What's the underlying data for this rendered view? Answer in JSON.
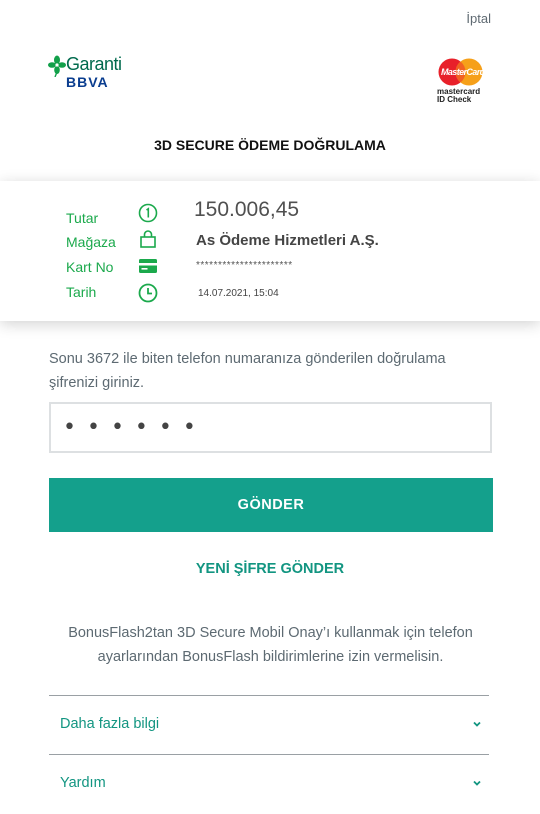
{
  "header": {
    "cancel_label": "İptal",
    "bank_logo": {
      "line1": "Garanti",
      "line2": "BBVA",
      "icon": "clover-logo-icon"
    },
    "card_logo": {
      "word": "MasterCard",
      "line1": "mastercard",
      "line2": "ID Check",
      "icon": "mastercard-logo-icon"
    }
  },
  "title": "3D SECURE ÖDEME DOĞRULAMA",
  "summary": {
    "rows": [
      {
        "label": "Tutar",
        "icon": "amount-info-icon",
        "value": "150.006,45"
      },
      {
        "label": "Mağaza",
        "icon": "shopping-bag-icon",
        "value": "As Ödeme Hizmetleri A.Ş."
      },
      {
        "label": "Kart No",
        "icon": "credit-card-icon",
        "value": "**********************"
      },
      {
        "label": "Tarih",
        "icon": "clock-icon",
        "value": "14.07.2021, 15:04"
      }
    ]
  },
  "instruction": "Sonu 3672 ile biten telefon numaranıza gönderilen doğrulama şifrenizi giriniz.",
  "otp": {
    "value": "••••••"
  },
  "submit_label": "GÖNDER",
  "resend_label": "YENİ ŞİFRE GÖNDER",
  "notice": "BonusFlash2tan 3D Secure Mobil Onay’ı kullanmak için telefon ayarlarından BonusFlash bildirimlerine izin vermelisin.",
  "accordion": [
    {
      "label": "Daha fazla bilgi",
      "icon": "chevron-down-icon"
    },
    {
      "label": "Yardım",
      "icon": "chevron-down-icon"
    }
  ],
  "colors": {
    "brand_green": "#1ba94c",
    "teal": "#14a08c",
    "teal_text": "#129581",
    "body_text": "#5d6a72"
  }
}
